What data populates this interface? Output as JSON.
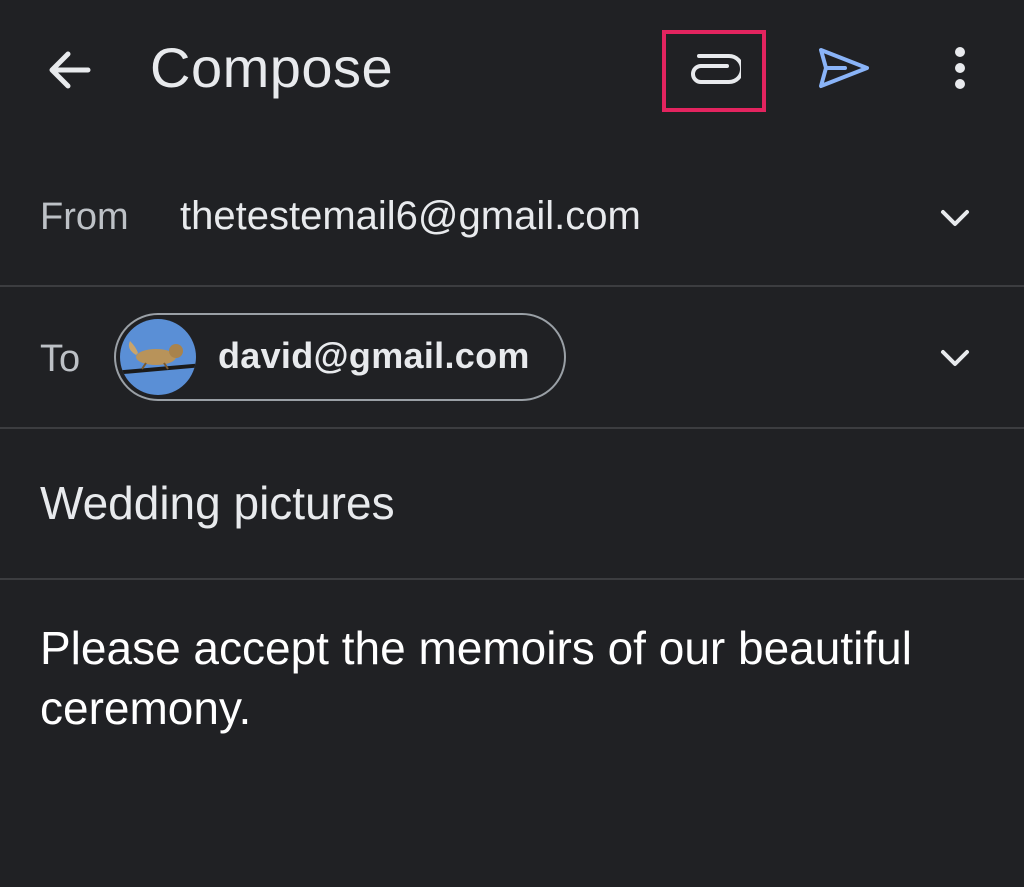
{
  "appbar": {
    "title": "Compose",
    "back_icon": "arrow-back-icon",
    "attach_icon": "paperclip-icon",
    "send_icon": "send-icon",
    "more_icon": "more-vert-icon",
    "highlight_color": "#e3245f",
    "send_color": "#8ab4f8"
  },
  "from": {
    "label": "From",
    "value": "thetestemail6@gmail.com",
    "expand_icon": "chevron-down-icon"
  },
  "to": {
    "label": "To",
    "recipient": "david@gmail.com",
    "avatar": "squirrel-avatar-image",
    "expand_icon": "chevron-down-icon"
  },
  "subject": {
    "value": "Wedding pictures"
  },
  "body": {
    "value": "Please accept the memoirs of our beautiful ceremony."
  }
}
